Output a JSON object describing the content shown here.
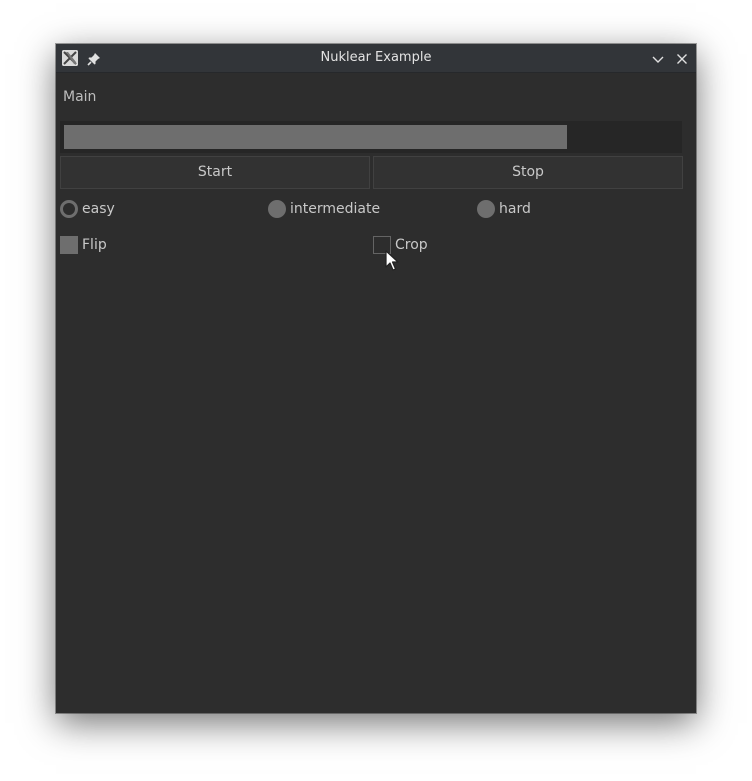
{
  "window": {
    "title": "Nuklear Example",
    "icons": {
      "app": "x11-app-icon",
      "pin": "pin-icon",
      "minimize": "chevron-down-icon",
      "close": "close-icon"
    }
  },
  "panel": {
    "title": "Main",
    "progress": {
      "value_fraction": 0.82
    },
    "buttons": {
      "start": "Start",
      "stop": "Stop"
    },
    "difficulty": {
      "options": [
        "easy",
        "intermediate",
        "hard"
      ],
      "selected": "easy"
    },
    "options": {
      "flip": {
        "label": "Flip",
        "checked": true
      },
      "crop": {
        "label": "Crop",
        "checked": false
      }
    }
  },
  "colors": {
    "window_bg": "#2d2d2d",
    "titlebar_bg": "#323539",
    "widget_fill": "#6e6e6e",
    "button_bg": "#323232",
    "text": "#c8c8c8"
  }
}
